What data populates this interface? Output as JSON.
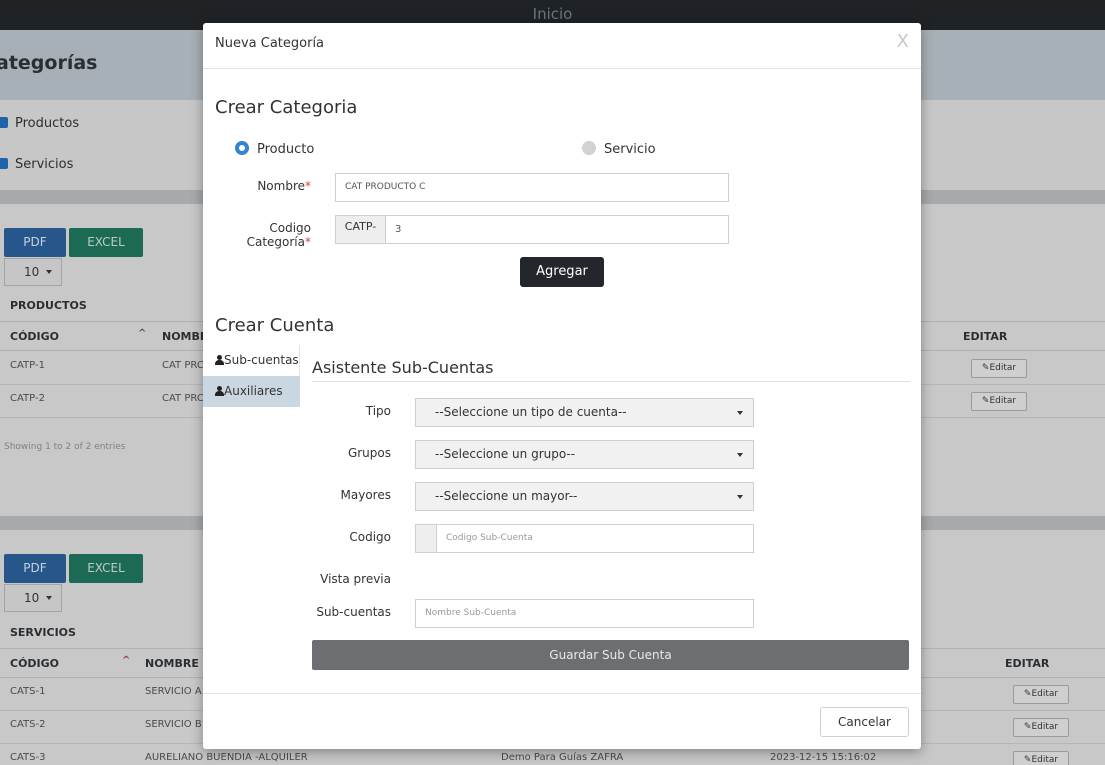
{
  "app": {
    "title": "Inicio"
  },
  "page": {
    "heading": "ategorías",
    "filters": [
      {
        "label": "Productos"
      },
      {
        "label": "Servicios"
      }
    ]
  },
  "productos": {
    "pdf_label": "PDF",
    "excel_label": "EXCEL",
    "page_size": "10",
    "section_title": "PRODUCTOS",
    "columns": {
      "codigo": "CÓDIGO",
      "nombre": "NOMBR",
      "editar": "EDITAR"
    },
    "rows": [
      {
        "codigo": "CATP-1",
        "nombre": "CAT PRC",
        "edit_label": "Editar"
      },
      {
        "codigo": "CATP-2",
        "nombre": "CAT PRC",
        "edit_label": "Editar"
      }
    ],
    "info": "Showing 1 to 2 of 2 entries"
  },
  "servicios": {
    "pdf_label": "PDF",
    "excel_label": "EXCEL",
    "page_size": "10",
    "section_title": "SERVICIOS",
    "columns": {
      "codigo": "CÓDIGO",
      "nombre": "NOMBRE",
      "editar": "EDITAR"
    },
    "rows": [
      {
        "codigo": "CATS-1",
        "nombre": "SERVICIO A",
        "edit_label": "Editar"
      },
      {
        "codigo": "CATS-2",
        "nombre": "SERVICIO B",
        "edit_label": "Editar"
      },
      {
        "codigo": "CATS-3",
        "nombre": "AURELIANO BUENDIA -ALQUILER",
        "empresa": "Demo Para Guías ZAFRA",
        "fecha": "2023-12-15 15:16:02",
        "edit_label": "Editar"
      }
    ]
  },
  "modal": {
    "title": "Nueva Categoría",
    "close": "X",
    "crear_categoria": "Crear Categoria",
    "radio_producto": "Producto",
    "radio_servicio": "Servicio",
    "nombre_label": "Nombre",
    "nombre_value": "CAT PRODUCTO C",
    "codigo_label": "Codigo Categoría",
    "codigo_prefix": "CATP-",
    "codigo_value": "3",
    "required_mark": "*",
    "agregar": "Agregar",
    "crear_cuenta": "Crear Cuenta",
    "tabs": [
      {
        "label": "Sub-cuentas"
      },
      {
        "label": "Auxiliares"
      }
    ],
    "wizard_title": "Asistente Sub-Cuentas",
    "tipo_label": "Tipo",
    "tipo_value": "--Seleccione un tipo de cuenta--",
    "grupos_label": "Grupos",
    "grupos_value": "--Seleccione un grupo--",
    "mayores_label": "Mayores",
    "mayores_value": "--Seleccione un mayor--",
    "codigo_sub_label": "Codigo",
    "codigo_sub_placeholder": "Codigo Sub-Cuenta",
    "vista_previa": "Vista previa",
    "subcuentas_label": "Sub-cuentas",
    "subcuentas_placeholder": "Nombre Sub-Cuenta",
    "guardar": "Guardar Sub Cuenta",
    "cancelar": "Cancelar"
  },
  "colors": {
    "primary": "#3385d0",
    "dark_button": "#23272b",
    "grey_button": "#6c6e71",
    "required": "#d63a3a"
  }
}
